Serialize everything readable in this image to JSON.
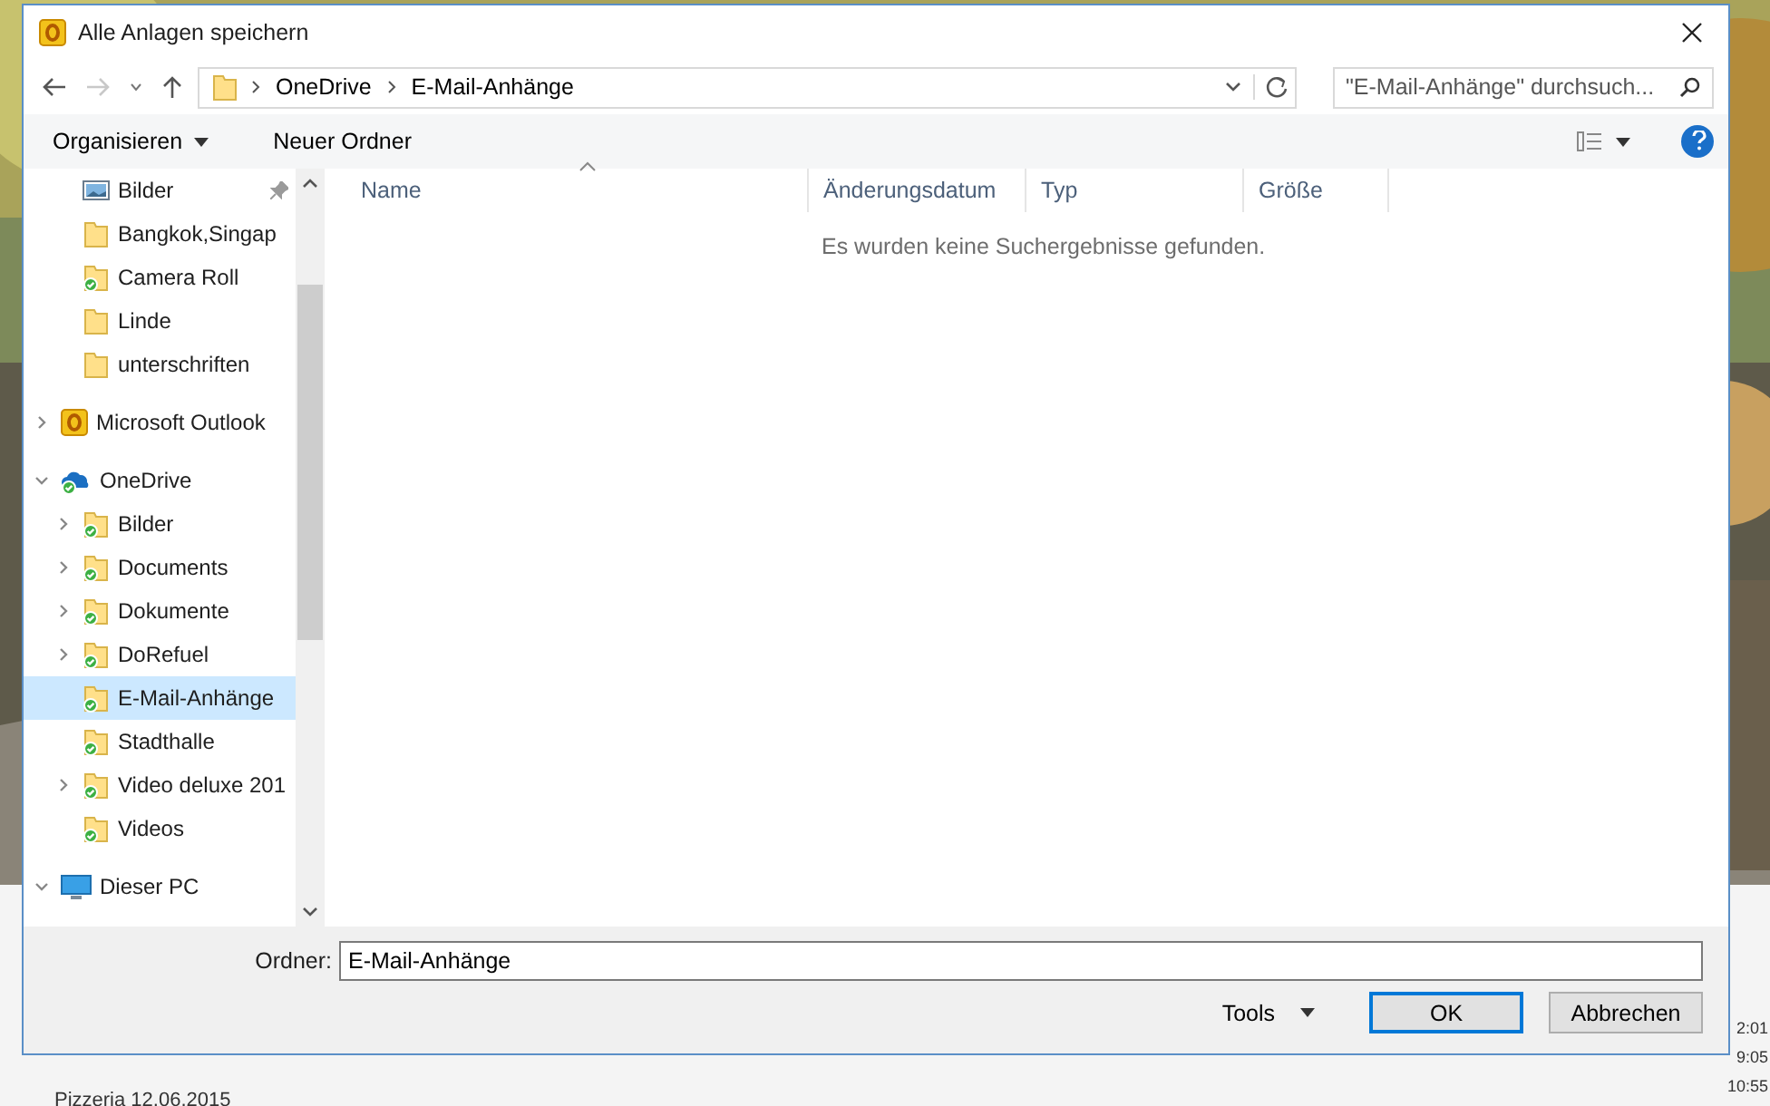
{
  "window": {
    "title": "Alle Anlagen speichern"
  },
  "address_bar": {
    "path": [
      "OneDrive",
      "E-Mail-Anhänge"
    ]
  },
  "search": {
    "placeholder": "\"E-Mail-Anhänge\" durchsuch..."
  },
  "toolbar": {
    "organize": "Organisieren",
    "new_folder": "Neuer Ordner"
  },
  "sidebar": {
    "quick_access": [
      {
        "label": "Bilder",
        "kind": "pictures",
        "pinned": true,
        "selected": false
      },
      {
        "label": "Bangkok,Singap",
        "kind": "folder",
        "pinned": false,
        "selected": false
      },
      {
        "label": "Camera Roll",
        "kind": "sync-folder",
        "pinned": false,
        "selected": false
      },
      {
        "label": "Linde",
        "kind": "folder",
        "pinned": false,
        "selected": false
      },
      {
        "label": "unterschriften",
        "kind": "folder",
        "pinned": false,
        "selected": false
      }
    ],
    "tree": [
      {
        "label": "Microsoft Outlook",
        "kind": "outlook",
        "expanded": false,
        "selected": false
      },
      {
        "label": "OneDrive",
        "kind": "onedrive",
        "expanded": true,
        "selected": false,
        "children": [
          {
            "label": "Bilder",
            "kind": "sync-folder",
            "expanded": false,
            "selected": false
          },
          {
            "label": "Documents",
            "kind": "sync-folder",
            "expanded": false,
            "selected": false
          },
          {
            "label": "Dokumente",
            "kind": "sync-folder",
            "expanded": false,
            "selected": false
          },
          {
            "label": "DoRefuel",
            "kind": "sync-folder",
            "expanded": false,
            "selected": false
          },
          {
            "label": "E-Mail-Anhänge",
            "kind": "sync-folder",
            "selected": true
          },
          {
            "label": "Stadthalle",
            "kind": "sync-folder",
            "selected": false
          },
          {
            "label": "Video deluxe 201",
            "kind": "sync-folder",
            "expanded": false,
            "selected": false
          },
          {
            "label": "Videos",
            "kind": "sync-folder",
            "selected": false
          }
        ]
      },
      {
        "label": "Dieser PC",
        "kind": "pc",
        "expanded": true,
        "selected": false
      }
    ]
  },
  "table": {
    "columns": [
      "Name",
      "Änderungsdatum",
      "Typ",
      "Größe"
    ],
    "empty_message": "Es wurden keine Suchergebnisse gefunden."
  },
  "folder_field": {
    "label": "Ordner:",
    "value": "E-Mail-Anhänge"
  },
  "buttons": {
    "tools": "Tools",
    "ok": "OK",
    "cancel": "Abbrechen"
  },
  "background_window": {
    "item": "Pizzeria 12.06.2015",
    "times": [
      "2:01",
      "9:05",
      "10:55"
    ]
  }
}
